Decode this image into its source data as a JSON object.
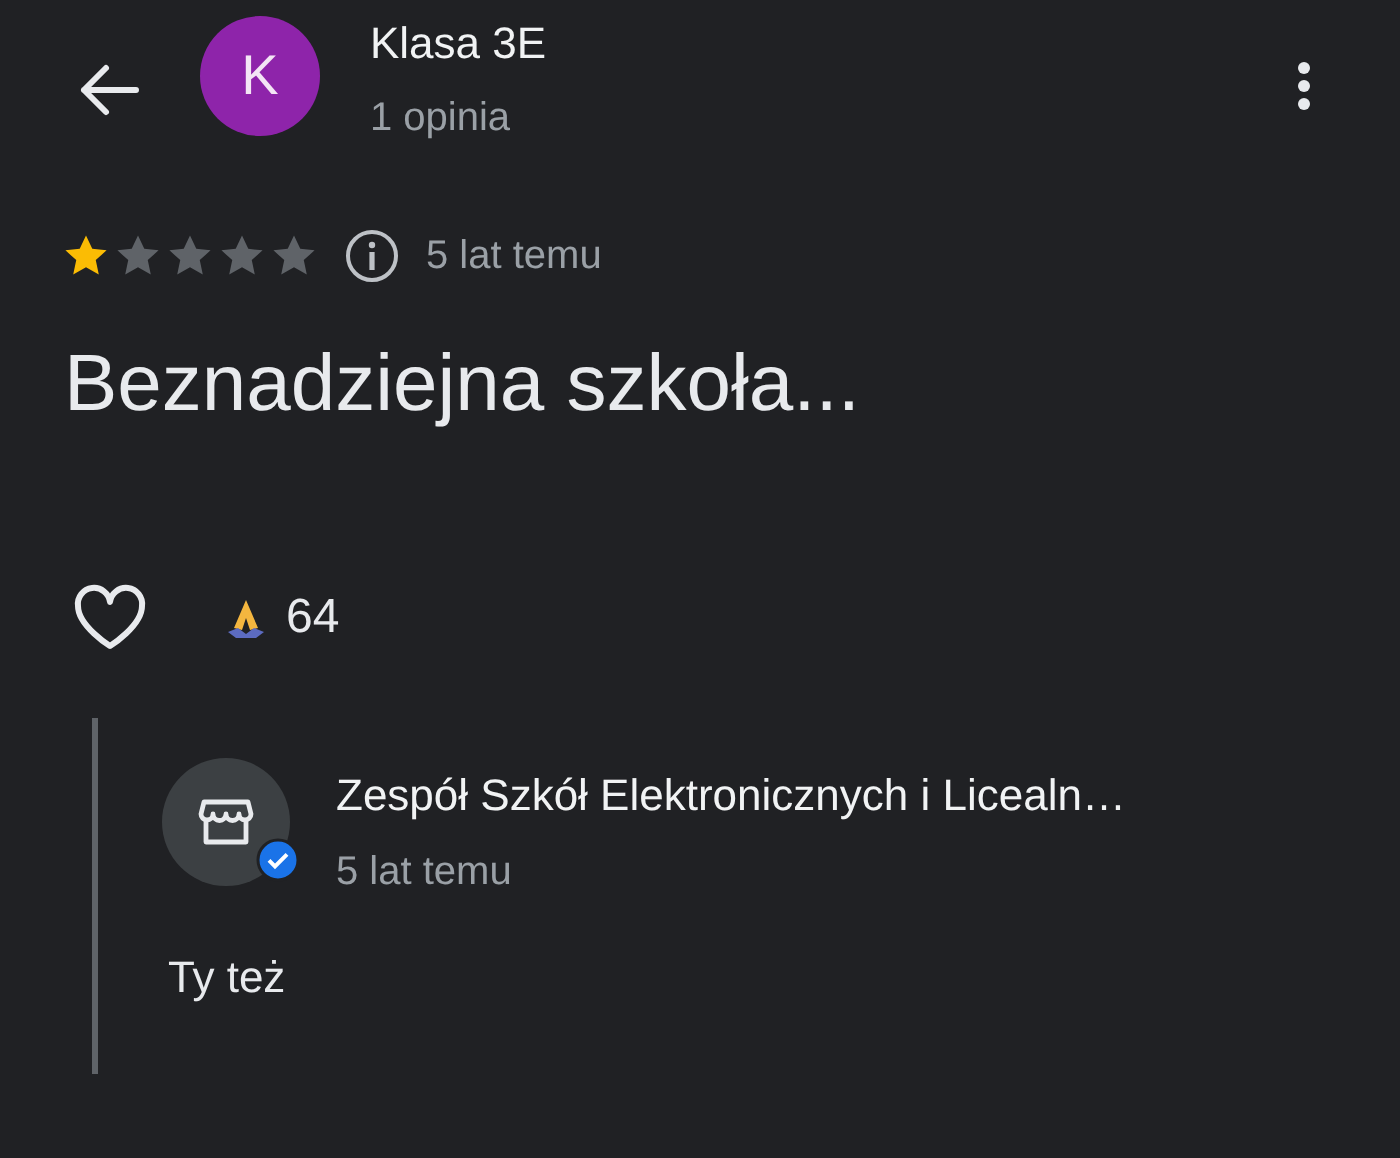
{
  "header": {
    "avatar_letter": "K",
    "title": "Klasa 3E",
    "subtitle": "1 opinia"
  },
  "review": {
    "stars": 1,
    "time": "5 lat temu",
    "text": "Beznadziejna szkoła...",
    "liked": false,
    "reaction_count": "64"
  },
  "reply": {
    "author": "Zespół Szkół Elektronicznych i Licealn…",
    "verified": true,
    "time": "5 lat temu",
    "text": "Ty też"
  }
}
